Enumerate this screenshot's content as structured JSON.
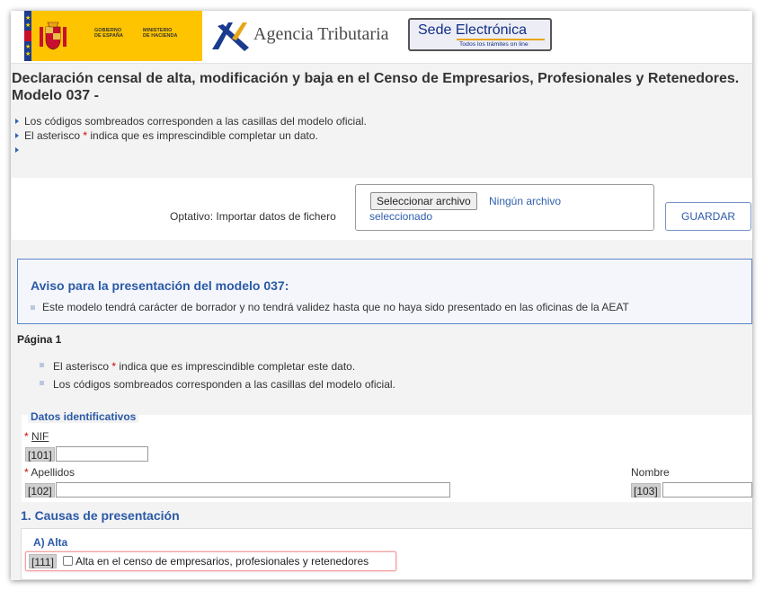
{
  "header": {
    "gov_logo": {
      "line1": "GOBIERNO",
      "line2": "DE ESPAÑA",
      "ministry1": "MINISTERIO",
      "ministry2": "DE HACIENDA",
      "brand_colors": [
        "#ffc400",
        "#1b3d92",
        "#c8102e"
      ]
    },
    "agency": "Agencia Tributaria",
    "sede": {
      "title": "Sede Electrónica",
      "subtitle": "Todos los trámites on line"
    }
  },
  "page_title": "Declaración censal de alta, modificación y baja en el Censo de Empresarios, Profesionales y Retenedores. Modelo 037 -",
  "notes": [
    {
      "text": "Los códigos sombreados corresponden a las casillas del modelo oficial."
    },
    {
      "before": "El asterisco ",
      "mark": "*",
      "after": " indica que es imprescindible completar un dato."
    },
    {
      "text": ""
    }
  ],
  "import": {
    "label": "Optativo: Importar datos de fichero",
    "file_button": "Seleccionar archivo",
    "file_status": "Ningún archivo seleccionado",
    "save_button": "GUARDAR"
  },
  "aviso": {
    "title": "Aviso para la presentación del modelo 037:",
    "item": "Este modelo tendrá carácter de borrador y no tendrá validez hasta que no haya sido presentado en las oficinas de la AEAT"
  },
  "page": {
    "label": "Página 1",
    "notes": [
      {
        "before": "El asterisco ",
        "mark": "*",
        "after": " indica que es imprescindible completar este dato."
      },
      {
        "text": "Los códigos sombreados corresponden a las casillas del modelo oficial."
      }
    ]
  },
  "datos": {
    "legend": "Datos identificativos",
    "required_mark": "*",
    "nif": {
      "label": "NIF",
      "code": "[101]",
      "value": ""
    },
    "apellidos": {
      "label": "Apellidos",
      "code": "[102]",
      "value": ""
    },
    "nombre": {
      "label": "Nombre",
      "code": "[103]",
      "value": ""
    }
  },
  "causas": {
    "title": "1. Causas de presentación",
    "alta": {
      "title": "A) Alta",
      "code": "[111]",
      "checkbox_label": "Alta en el censo de empresarios, profesionales y retenedores",
      "checked": false
    }
  },
  "colors": {
    "accent_blue": "#2b5aa6",
    "required_red": "#d00000",
    "highlight_red": "#f0a0a0"
  }
}
